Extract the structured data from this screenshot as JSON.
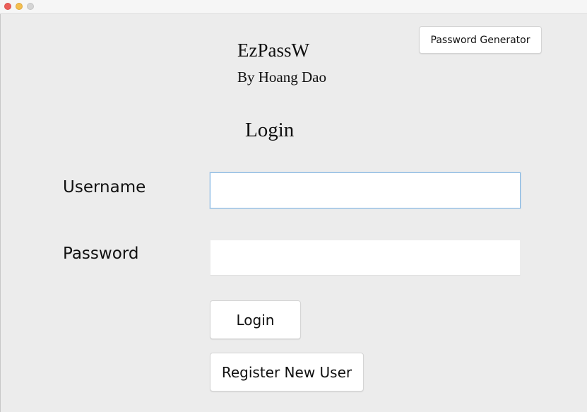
{
  "window": {
    "controls": [
      "close-button",
      "minimize-button",
      "maximize-button"
    ]
  },
  "header": {
    "app_title": "EzPassW",
    "author": "By Hoang Dao",
    "password_generator_label": "Password Generator"
  },
  "login": {
    "section_title": "Login",
    "username_label": "Username",
    "username_value": "",
    "username_placeholder": "",
    "password_label": "Password",
    "password_value": "",
    "password_placeholder": "",
    "login_button_label": "Login",
    "register_button_label": "Register New User"
  },
  "colors": {
    "window_background": "#ececec",
    "focus_border": "#86b8e3",
    "close": "#ec5f5a",
    "minimize": "#f4bf4f",
    "maximize": "#d5d5d5"
  }
}
